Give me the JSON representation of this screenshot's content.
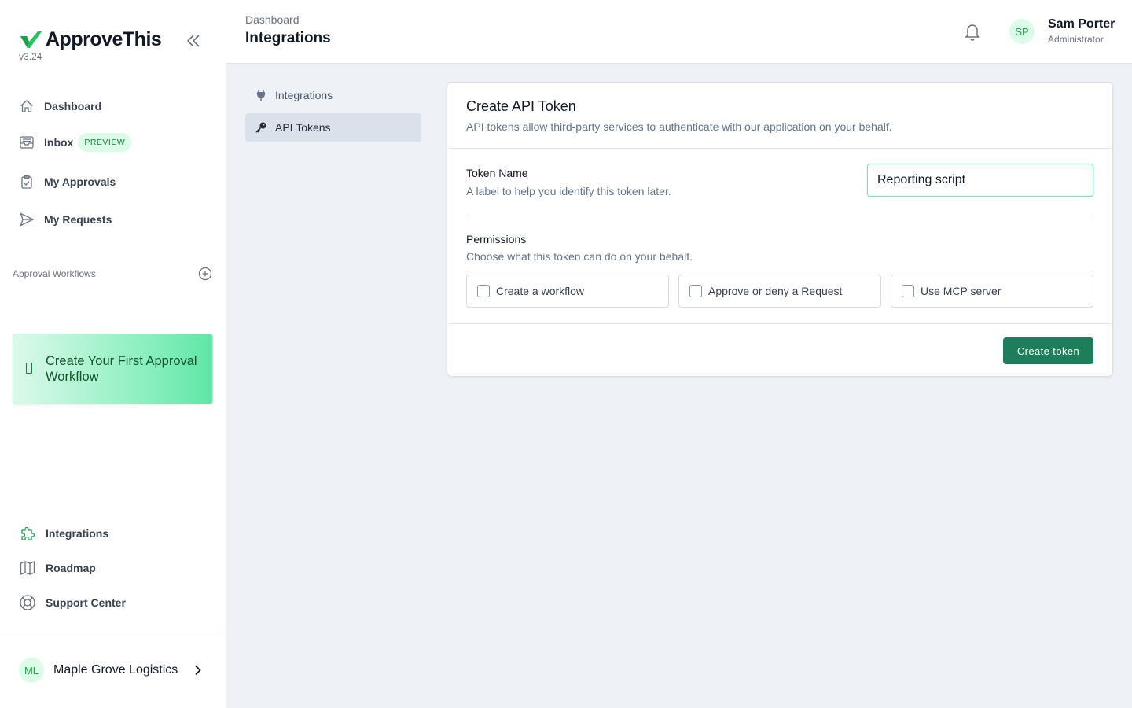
{
  "app": {
    "name": "ApproveThis",
    "version": "v3.24",
    "brand_color": "#22c55e",
    "icons": {
      "logo": "check-logo-icon",
      "collapse": "double-chevron-left-icon"
    }
  },
  "sidebar": {
    "items": [
      {
        "label": "Dashboard",
        "icon": "home-icon"
      },
      {
        "label": "Inbox",
        "icon": "inbox-icon",
        "badge": "PREVIEW"
      },
      {
        "label": "My Approvals",
        "icon": "clipboard-check-icon"
      },
      {
        "label": "My Requests",
        "icon": "send-icon"
      }
    ],
    "workflows": {
      "title": "Approval Workflows",
      "add_icon": "plus-circle-icon",
      "create_label": "Create Your First Approval Workflow"
    },
    "bottom_items": [
      {
        "label": "Integrations",
        "icon": "puzzle-icon"
      },
      {
        "label": "Roadmap",
        "icon": "map-icon"
      },
      {
        "label": "Support Center",
        "icon": "lifebuoy-icon"
      }
    ],
    "org": {
      "initials": "ML",
      "name": "Maple Grove Logistics",
      "icon": "chevron-right-icon"
    }
  },
  "header": {
    "breadcrumb": "Dashboard",
    "title": "Integrations",
    "bell_icon": "bell-icon",
    "user": {
      "initials": "SP",
      "name": "Sam Porter",
      "role": "Administrator"
    }
  },
  "subnav": {
    "items": [
      {
        "label": "Integrations",
        "icon": "plug-icon",
        "active": false
      },
      {
        "label": "API Tokens",
        "icon": "key-icon",
        "active": true
      }
    ]
  },
  "form": {
    "title": "Create API Token",
    "description": "API tokens allow third-party services to authenticate with our application on your behalf.",
    "token_name": {
      "label": "Token Name",
      "help": "A label to help you identify this token later.",
      "value": "Reporting script"
    },
    "permissions": {
      "label": "Permissions",
      "help": "Choose what this token can do on your behalf.",
      "options": [
        {
          "label": "Create a workflow",
          "checked": false
        },
        {
          "label": "Approve or deny a Request",
          "checked": false
        },
        {
          "label": "Use MCP server",
          "checked": false
        }
      ]
    },
    "submit_label": "Create token",
    "accent_color": "#1e7d5a"
  }
}
